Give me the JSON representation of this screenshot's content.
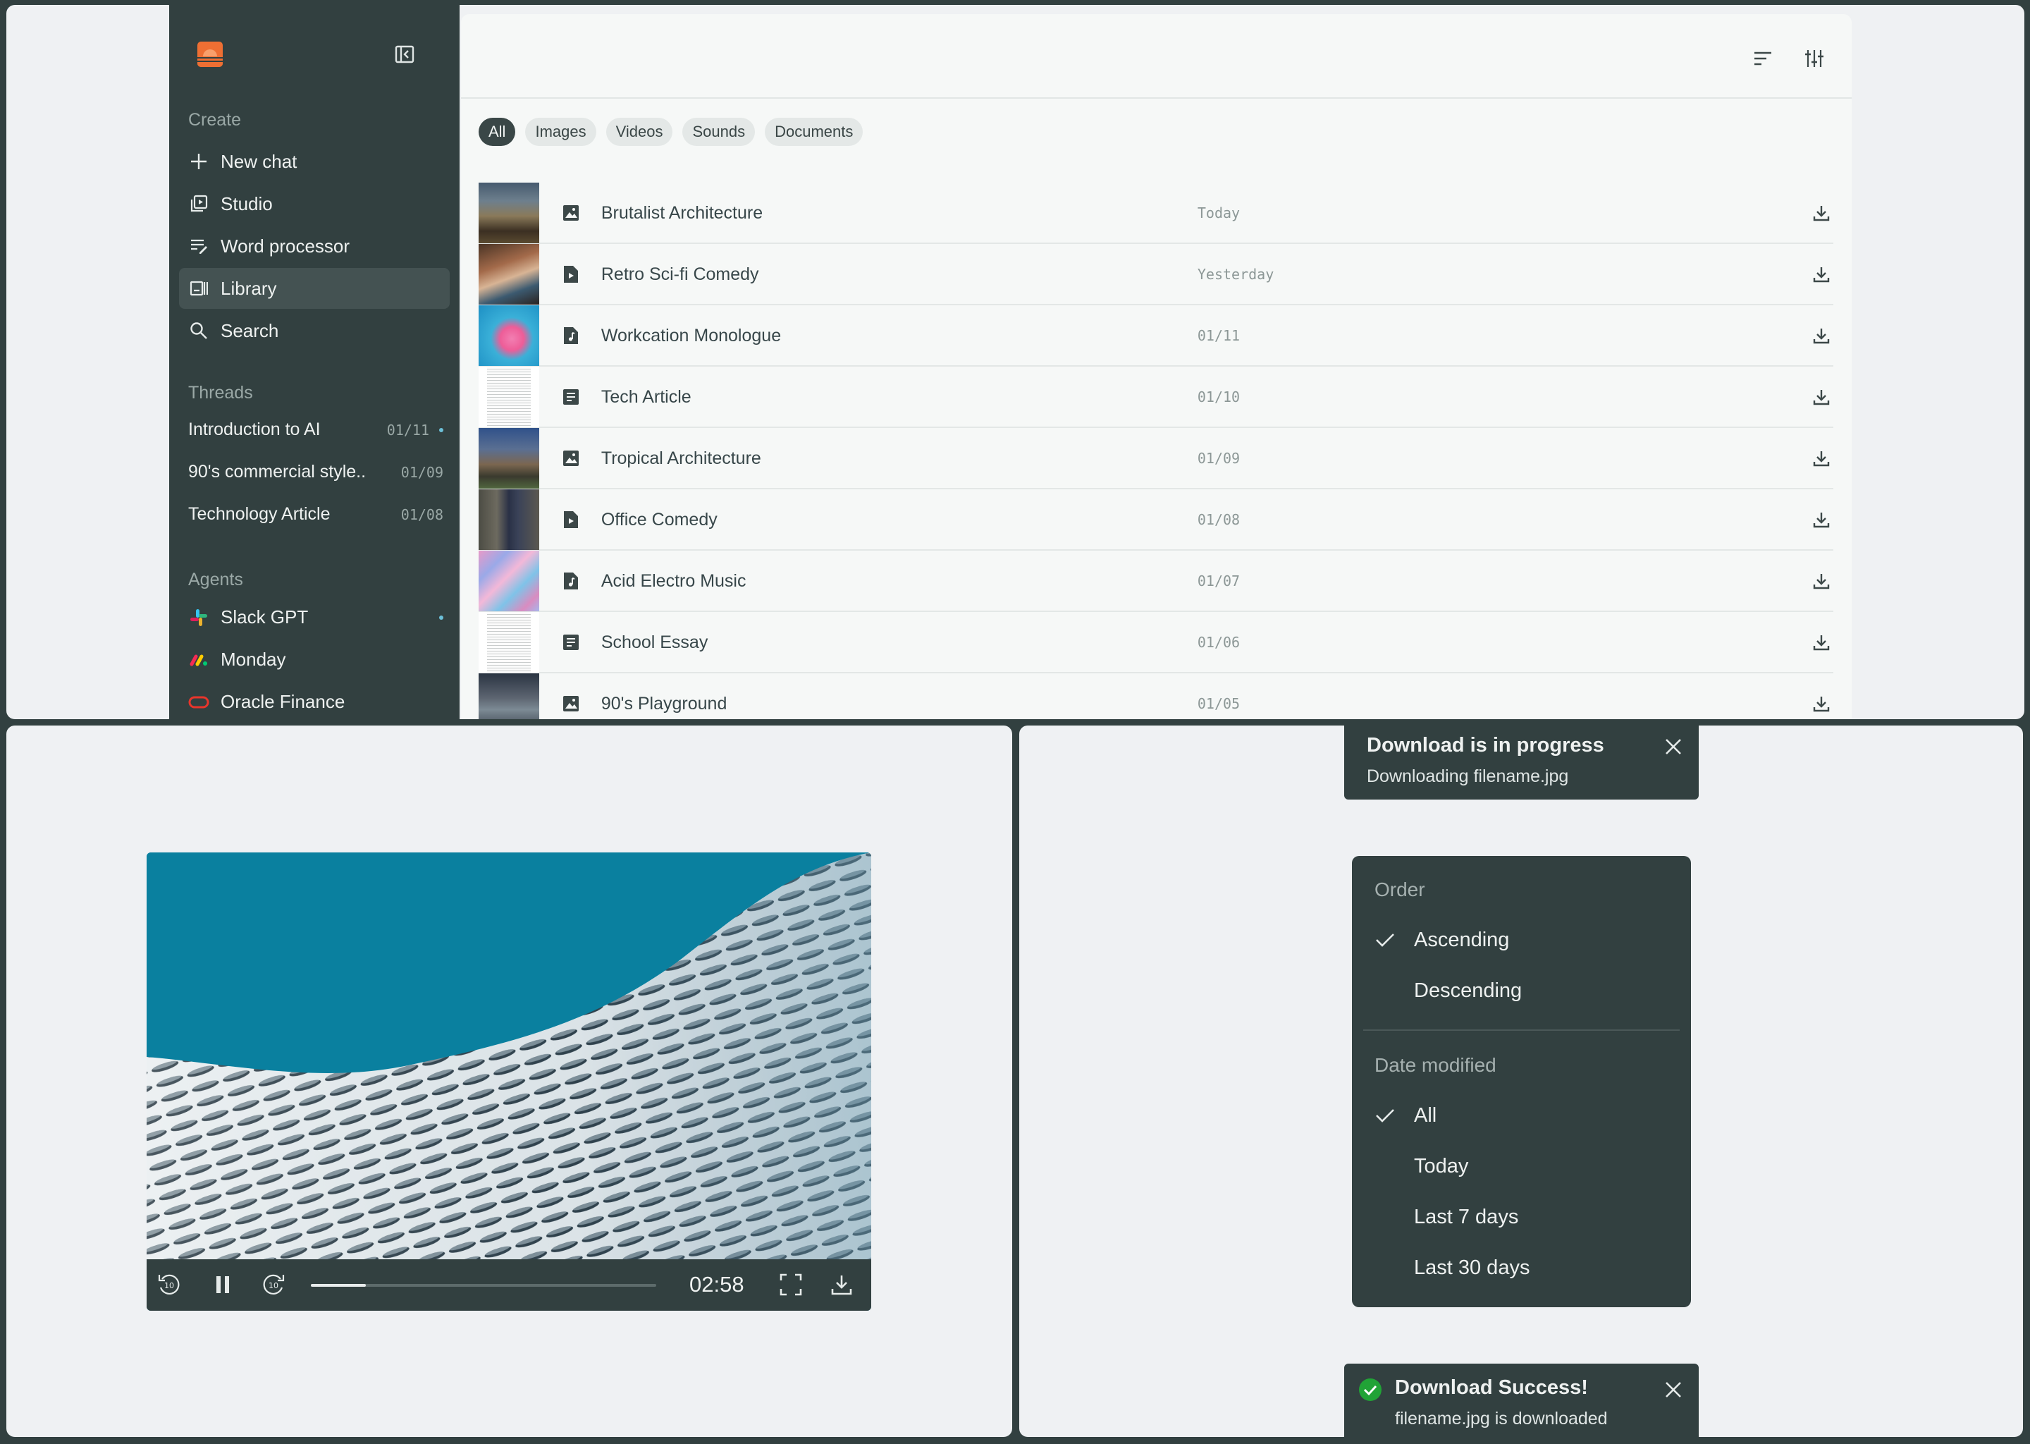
{
  "sidebar": {
    "create_heading": "Create",
    "nav": [
      {
        "label": "New chat",
        "icon": "plus-icon"
      },
      {
        "label": "Studio",
        "icon": "studio-icon"
      },
      {
        "label": "Word processor",
        "icon": "word-processor-icon"
      },
      {
        "label": "Library",
        "icon": "library-icon",
        "active": true
      },
      {
        "label": "Search",
        "icon": "search-icon"
      }
    ],
    "threads_heading": "Threads",
    "threads": [
      {
        "name": "Introduction to AI",
        "date": "01/11",
        "unread": true
      },
      {
        "name": "90's commercial style..",
        "date": "01/09",
        "unread": false
      },
      {
        "name": "Technology Article",
        "date": "01/08",
        "unread": false
      }
    ],
    "agents_heading": "Agents",
    "agents": [
      {
        "name": "Slack GPT",
        "icon": "slack-icon",
        "unread": true
      },
      {
        "name": "Monday",
        "icon": "monday-icon",
        "unread": false
      },
      {
        "name": "Oracle Finance",
        "icon": "oracle-icon",
        "unread": false
      }
    ]
  },
  "library": {
    "filters": [
      {
        "label": "All",
        "active": true
      },
      {
        "label": "Images",
        "active": false
      },
      {
        "label": "Videos",
        "active": false
      },
      {
        "label": "Sounds",
        "active": false
      },
      {
        "label": "Documents",
        "active": false
      }
    ],
    "items": [
      {
        "name": "Brutalist Architecture",
        "date": "Today",
        "type": "image-icon"
      },
      {
        "name": "Retro Sci-fi Comedy",
        "date": "Yesterday",
        "type": "video-file-icon"
      },
      {
        "name": "Workcation Monologue",
        "date": "01/11",
        "type": "audio-file-icon"
      },
      {
        "name": "Tech Article",
        "date": "01/10",
        "type": "document-icon"
      },
      {
        "name": "Tropical Architecture",
        "date": "01/09",
        "type": "image-icon"
      },
      {
        "name": "Office Comedy",
        "date": "01/08",
        "type": "video-file-icon"
      },
      {
        "name": "Acid Electro Music",
        "date": "01/07",
        "type": "audio-file-icon"
      },
      {
        "name": "School Essay",
        "date": "01/06",
        "type": "document-icon"
      },
      {
        "name": "90's Playground",
        "date": "01/05",
        "type": "image-icon"
      }
    ]
  },
  "video": {
    "time": "02:58",
    "progress": 0.16
  },
  "toast_progress": {
    "title": "Download is in progress",
    "message": "Downloading filename.jpg"
  },
  "toast_success": {
    "title": "Download Success!",
    "message": "filename.jpg is downloaded"
  },
  "sort_menu": {
    "order_heading": "Order",
    "order_options": [
      {
        "label": "Ascending",
        "checked": true
      },
      {
        "label": "Descending",
        "checked": false
      }
    ],
    "date_heading": "Date modified",
    "date_options": [
      {
        "label": "All",
        "checked": true
      },
      {
        "label": "Today",
        "checked": false
      },
      {
        "label": "Last 7 days",
        "checked": false
      },
      {
        "label": "Last 30 days",
        "checked": false
      }
    ]
  },
  "colors": {
    "sidebar_bg": "#324040",
    "brand": "#ee6f33",
    "success": "#21a336",
    "unread_dot": "#6cc0d8"
  }
}
